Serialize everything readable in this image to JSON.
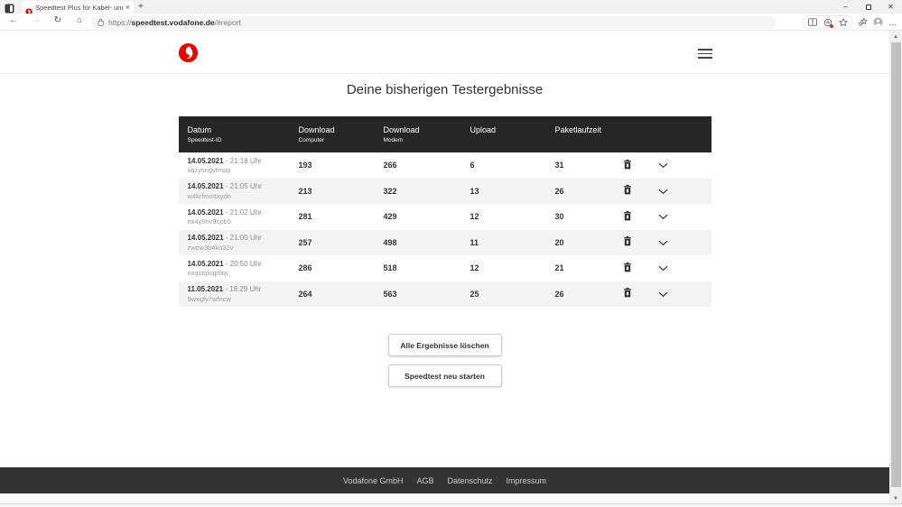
{
  "browser": {
    "tab_title": "Speedtest Plus für Kabel- und D…",
    "new_tab_icon": "+",
    "close_tab_icon": "×",
    "icons": {
      "back": "←",
      "forward": "→",
      "refresh": "↻",
      "home": "⌂",
      "minimize": "–",
      "close_window": "✕",
      "more_menu": "…"
    },
    "url": {
      "prefix": "https://",
      "domain": "speedtest.vodafone.de",
      "suffix": "/#report"
    }
  },
  "page": {
    "title": "Deine bisherigen Testergebnisse"
  },
  "table": {
    "datetime_separator": "-",
    "columns": [
      {
        "label": "Datum",
        "sublabel": "Speedtest-ID"
      },
      {
        "label": "Download",
        "sublabel": "Computer"
      },
      {
        "label": "Download",
        "sublabel": "Modem"
      },
      {
        "label": "Upload",
        "sublabel": ""
      },
      {
        "label": "Paketlaufzeit",
        "sublabel": ""
      }
    ],
    "rows": [
      {
        "date": "14.05.2021",
        "time": "21:18 Uhr",
        "id": "xqzysngvfmpp",
        "download_computer": "193",
        "download_modem": "266",
        "upload": "6",
        "paketlaufzeit": "31"
      },
      {
        "date": "14.05.2021",
        "time": "21:05 Uhr",
        "id": "w4krfmmtxydn",
        "download_computer": "213",
        "download_modem": "322",
        "upload": "13",
        "paketlaufzeit": "26"
      },
      {
        "date": "14.05.2021",
        "time": "21:02 Uhr",
        "id": "nx4y9nv9cpb5",
        "download_computer": "281",
        "download_modem": "429",
        "upload": "12",
        "paketlaufzeit": "30"
      },
      {
        "date": "14.05.2021",
        "time": "21:00 Uhr",
        "id": "zwcw3b4kn32v",
        "download_computer": "257",
        "download_modem": "498",
        "upload": "11",
        "paketlaufzeit": "20"
      },
      {
        "date": "14.05.2021",
        "time": "20:50 Uhr",
        "id": "nxqstqkqp9qc",
        "download_computer": "286",
        "download_modem": "518",
        "upload": "12",
        "paketlaufzeit": "21"
      },
      {
        "date": "11.05.2021",
        "time": "18:29 Uhr",
        "id": "9wxgfy7wfncw",
        "download_computer": "264",
        "download_modem": "563",
        "upload": "25",
        "paketlaufzeit": "26"
      }
    ]
  },
  "buttons": {
    "delete_all": "Alle Ergebnisse löschen",
    "restart": "Speedtest neu starten"
  },
  "footer": {
    "links": [
      "Vodafone GmbH",
      "AGB",
      "Datenschutz",
      "Impressum"
    ]
  },
  "colors": {
    "brand_red": "#e60000",
    "table_header_bg": "#262626",
    "footer_bg": "#333333",
    "row_alt_bg": "#f4f4f4"
  }
}
